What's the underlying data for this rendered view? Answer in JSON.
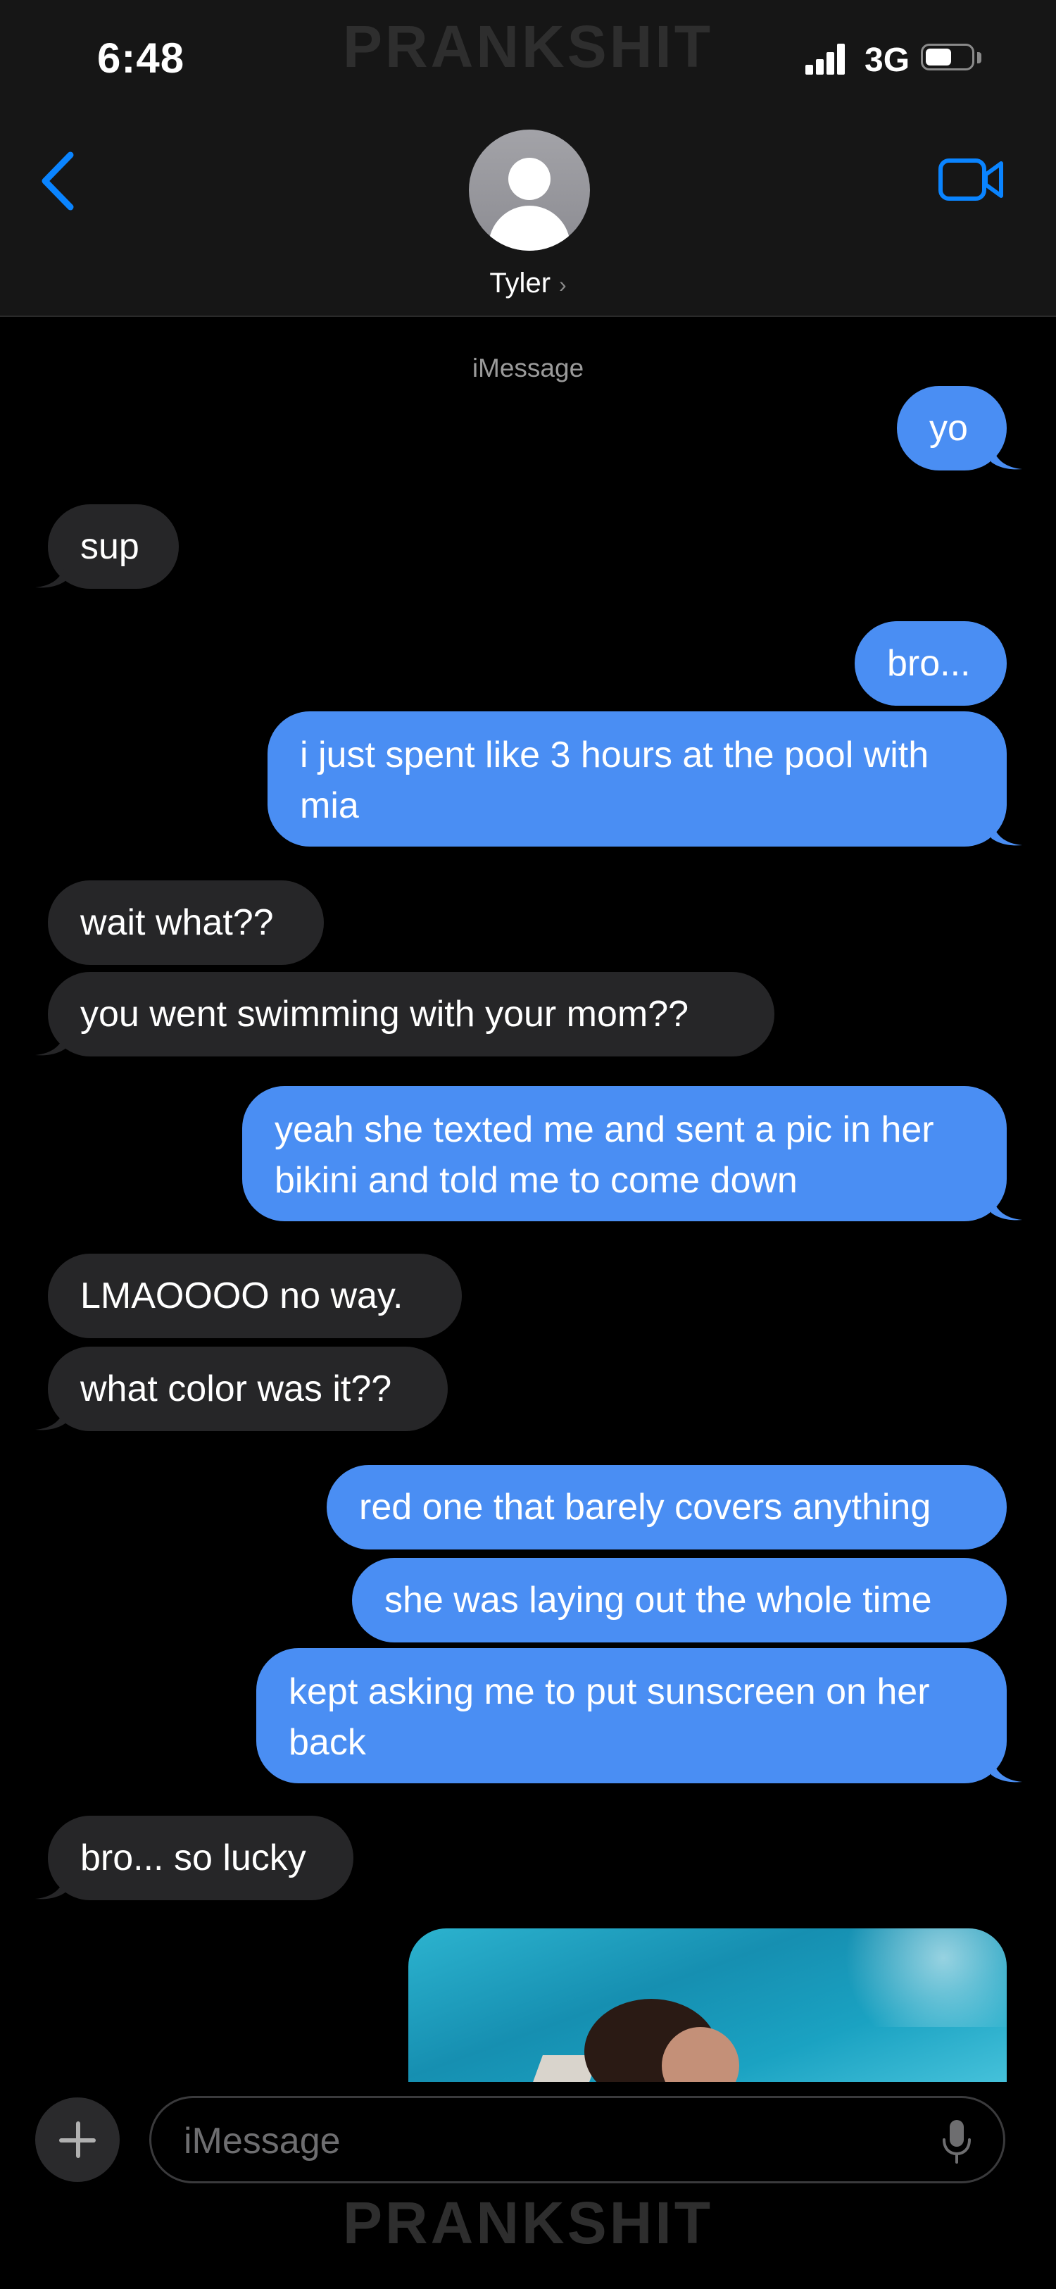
{
  "status_bar": {
    "time": "6:48",
    "network": "3G",
    "watermark": "PRANKSHIT"
  },
  "header": {
    "contact_name": "Tyler",
    "chevron": "›"
  },
  "conversation": {
    "service_label": "iMessage"
  },
  "messages": [
    {
      "text": "yo",
      "direction": "outgoing"
    },
    {
      "text": "sup",
      "direction": "incoming"
    },
    {
      "text": "bro...",
      "direction": "outgoing"
    },
    {
      "text": "i just spent like 3 hours at the pool with mia",
      "direction": "outgoing"
    },
    {
      "text": "wait what??",
      "direction": "incoming"
    },
    {
      "text": "you went swimming with your mom??",
      "direction": "incoming"
    },
    {
      "text": "yeah she texted me and sent a pic in her bikini and told me to come down",
      "direction": "outgoing"
    },
    {
      "text": "LMAOOOO no way.",
      "direction": "incoming"
    },
    {
      "text": "what color was it??",
      "direction": "incoming"
    },
    {
      "text": "red one that barely covers anything",
      "direction": "outgoing"
    },
    {
      "text": "she was laying out the whole time",
      "direction": "outgoing"
    },
    {
      "text": "kept asking me to put sunscreen on her back",
      "direction": "outgoing"
    },
    {
      "text": "bro... so lucky",
      "direction": "incoming"
    }
  ],
  "composer": {
    "placeholder": "iMessage"
  },
  "footer": {
    "watermark": "PRANKSHIT"
  },
  "icons": {
    "back": "chevron-left-icon",
    "video": "video-camera-icon",
    "avatar": "person-silhouette-icon",
    "add": "plus-icon",
    "mic": "microphone-icon"
  },
  "colors": {
    "accent": "#0a84ff",
    "outgoing_bubble": "#4a8ef3",
    "incoming_bubble": "#262628",
    "background": "#000000"
  }
}
